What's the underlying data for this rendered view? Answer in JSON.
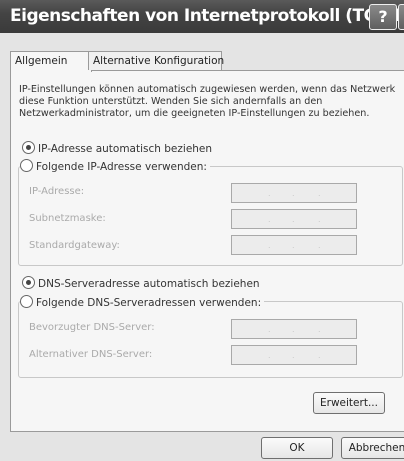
{
  "window": {
    "title": "Eigenschaften von Internetprotokoll (TCP/IP)",
    "help_glyph": "?"
  },
  "tabs": [
    {
      "label": "Allgemein",
      "active": true
    },
    {
      "label": "Alternative Konfiguration",
      "active": false
    }
  ],
  "intro_text": "IP-Einstellungen können automatisch zugewiesen werden, wenn das Netzwerk diese Funktion unterstützt. Wenden Sie sich andernfalls an den Netzwerkadministrator, um die geeigneten IP-Einstellungen zu beziehen.",
  "ip": {
    "auto_label": "IP-Adresse automatisch beziehen",
    "manual_label": "Folgende IP-Adresse verwenden:",
    "selected": "auto",
    "fields": [
      {
        "label": "IP-Adresse:",
        "value": ". . ."
      },
      {
        "label": "Subnetzmaske:",
        "value": ". . ."
      },
      {
        "label": "Standardgateway:",
        "value": ". . ."
      }
    ]
  },
  "dns": {
    "auto_label": "DNS-Serveradresse automatisch beziehen",
    "manual_label": "Folgende DNS-Serveradressen verwenden:",
    "selected": "auto",
    "fields": [
      {
        "label": "Bevorzugter DNS-Server:",
        "value": ". . ."
      },
      {
        "label": "Alternativer DNS-Server:",
        "value": ". . ."
      }
    ]
  },
  "buttons": {
    "advanced": "Erweitert...",
    "ok": "OK",
    "cancel": "Abbrechen"
  }
}
